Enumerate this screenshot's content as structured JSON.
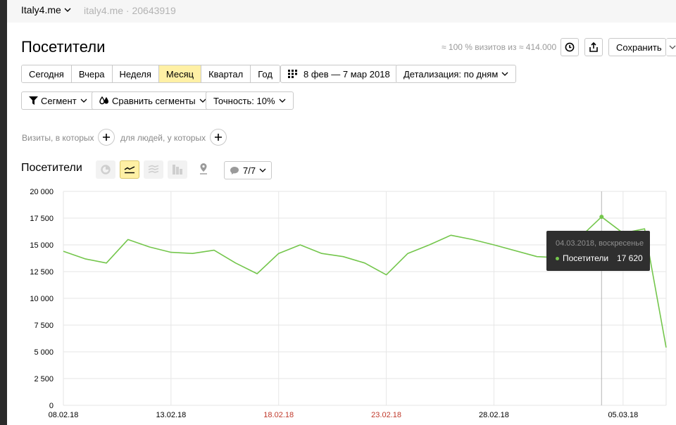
{
  "topbar": {
    "site": "Italy4.me",
    "site_sub": "italy4.me · 20643919"
  },
  "header": {
    "title": "Посетители",
    "sample": "≈ 100 % визитов из ≈ 414.000",
    "save_label": "Сохранить"
  },
  "periods": [
    {
      "label": "Сегодня",
      "active": false
    },
    {
      "label": "Вчера",
      "active": false
    },
    {
      "label": "Неделя",
      "active": false
    },
    {
      "label": "Месяц",
      "active": true
    },
    {
      "label": "Квартал",
      "active": false
    },
    {
      "label": "Год",
      "active": false
    }
  ],
  "date_range": "8 фев — 7 мар 2018",
  "detail": "Детализация: по дням",
  "segment_label": "Сегмент",
  "compare_label": "Сравнить сегменты",
  "accuracy": "Точность: 10%",
  "filters": {
    "visits_label": "Визиты, в которых",
    "people_label": "для людей, у которых"
  },
  "chart_section": {
    "title": "Посетители",
    "annotations": "7/7"
  },
  "tooltip": {
    "date": "04.03.2018, воскресенье",
    "series": "Посетители",
    "value": "17 620"
  },
  "colors": {
    "line": "#74c64c",
    "weekend": "#c0392b",
    "active": "#fff0a5"
  },
  "chart_data": {
    "type": "line",
    "series": [
      {
        "name": "Посетители",
        "values": [
          14400,
          13700,
          13300,
          15500,
          14800,
          14300,
          14200,
          14500,
          13300,
          12300,
          14200,
          15000,
          14200,
          13900,
          13300,
          12200,
          14200,
          15000,
          15900,
          15500,
          15000,
          13900,
          13800,
          17620,
          16100,
          16500,
          5400
        ]
      }
    ],
    "x": [
      "08.02.18",
      "09.02.18",
      "10.02.18",
      "11.02.18",
      "12.02.18",
      "13.02.18",
      "14.02.18",
      "15.02.18",
      "16.02.18",
      "17.02.18",
      "18.02.18",
      "19.02.18",
      "20.02.18",
      "21.02.18",
      "22.02.18",
      "23.02.18",
      "24.02.18",
      "25.02.18",
      "26.02.18",
      "27.02.18",
      "28.02.18",
      "01.03.18",
      "02.03.18",
      "04.03.18",
      "05.03.18",
      "06.03.18",
      "07.03.18"
    ],
    "x_ticks": [
      {
        "label": "08.02.18",
        "weekend": false
      },
      {
        "label": "13.02.18",
        "weekend": false
      },
      {
        "label": "18.02.18",
        "weekend": true
      },
      {
        "label": "23.02.18",
        "weekend": true
      },
      {
        "label": "28.02.18",
        "weekend": false
      },
      {
        "label": "05.03.18",
        "weekend": false
      }
    ],
    "y_ticks": [
      "0",
      "2 500",
      "5 000",
      "7 500",
      "10 000",
      "12 500",
      "15 000",
      "17 500",
      "20 000"
    ],
    "ylim": [
      0,
      20000
    ],
    "grid": true,
    "highlight": "04.03.18"
  }
}
